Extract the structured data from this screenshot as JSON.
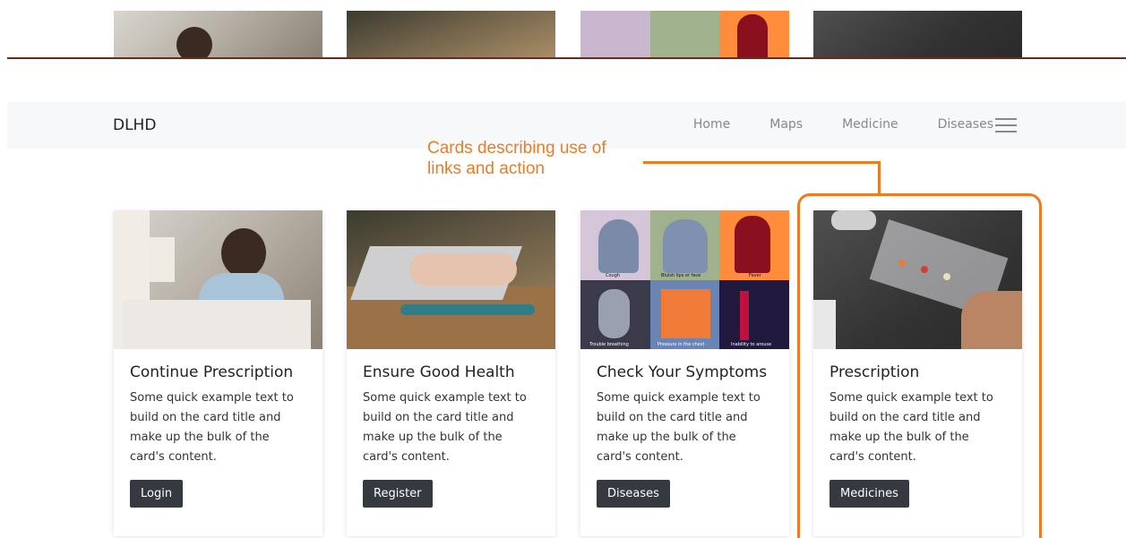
{
  "navbar": {
    "brand": "DLHD",
    "links": [
      "Home",
      "Maps",
      "Medicine",
      "Diseases"
    ]
  },
  "annotation": {
    "line1": "Cards describing use of",
    "line2": "links and action",
    "color": "#f07a22"
  },
  "cards": [
    {
      "title": "Continue Prescription",
      "text": "Some quick example text to build on the card title and make up the bulk of the card's content.",
      "button": "Login"
    },
    {
      "title": "Ensure Good Health",
      "text": "Some quick example text to build on the card title and make up the bulk of the card's content.",
      "button": "Register"
    },
    {
      "title": "Check Your Symptoms",
      "text": "Some quick example text to build on the card title and make up the bulk of the card's content.",
      "button": "Diseases"
    },
    {
      "title": "Prescription",
      "text": "Some quick example text to build on the card title and make up the bulk of the card's content.",
      "button": "Medicines"
    }
  ],
  "symptom_labels": [
    "Cough",
    "Bluish lips or face",
    "Fever",
    "Trouble breathing",
    "Pressure in the chest",
    "Inability to arouse"
  ],
  "colors": {
    "button_bg": "#343a40",
    "navbar_bg": "#f7f8f9"
  }
}
